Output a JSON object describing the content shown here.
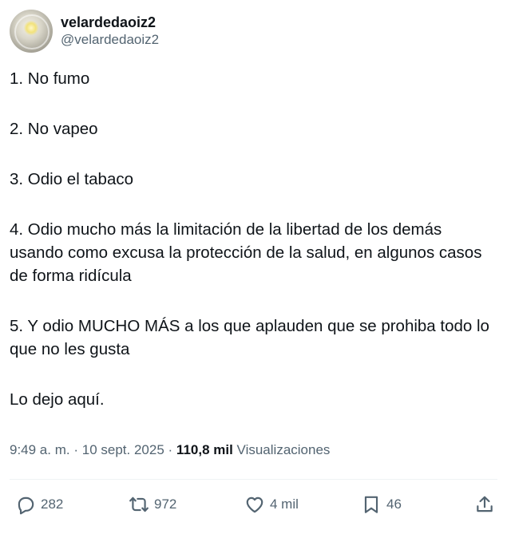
{
  "author": {
    "display_name": "velardedaoiz2",
    "handle": "@velardedaoiz2"
  },
  "tweet": {
    "paragraphs": [
      "1. No fumo",
      "2. No vapeo",
      "3. Odio el tabaco",
      "4. Odio mucho más la limitación de la libertad de los demás usando como excusa la protección de la salud, en algunos casos de forma ridícula",
      "5. Y odio MUCHO MÁS a los que aplauden que se prohiba todo lo que no les gusta",
      "Lo dejo aquí."
    ],
    "time": "9:49 a. m.",
    "separator": "·",
    "date": "10 sept. 2025",
    "views_count": "110,8 mil",
    "views_label": "Visualizaciones"
  },
  "actions": {
    "reply": {
      "icon": "reply-icon",
      "count": "282"
    },
    "retweet": {
      "icon": "retweet-icon",
      "count": "972"
    },
    "like": {
      "icon": "heart-icon",
      "count": "4 mil"
    },
    "bookmark": {
      "icon": "bookmark-icon",
      "count": "46"
    },
    "share": {
      "icon": "share-icon"
    }
  },
  "colors": {
    "text": "#0f1419",
    "secondary": "#536471",
    "divider": "#eff3f4",
    "background": "#ffffff"
  }
}
